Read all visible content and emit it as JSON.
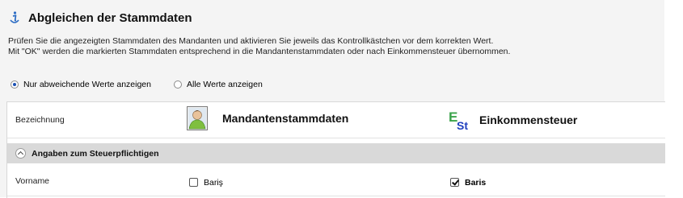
{
  "header": {
    "title": "Abgleichen der Stammdaten",
    "icon": "info-icon",
    "description_lines": [
      "Prüfen Sie die angezeigten Stammdaten des Mandanten und aktivieren Sie jeweils das Kontrollkästchen vor dem korrekten Wert.",
      "Mit \"OK\" werden die markierten Stammdaten entsprechend in die Mandantenstammdaten oder nach Einkommensteuer übernommen."
    ]
  },
  "filter": {
    "options": [
      {
        "label": "Nur abweichende Werte anzeigen",
        "selected": true
      },
      {
        "label": "Alle Werte anzeigen",
        "selected": false
      }
    ]
  },
  "table": {
    "header": {
      "label": "Bezeichnung",
      "col1": {
        "title": "Mandantenstammdaten",
        "icon": "person-icon"
      },
      "col2": {
        "title": "Einkommensteuer",
        "icon": "est-icon"
      }
    },
    "section": {
      "title": "Angaben zum Steuerpflichtigen",
      "icon": "chevron-up-icon"
    },
    "rows": [
      {
        "label": "Vorname",
        "col1_value": "Bariş",
        "col1_checked": false,
        "col2_value": "Baris",
        "col2_checked": true
      }
    ]
  },
  "colors": {
    "accent": "#1a4fb3",
    "section_bg": "#d9d9d9",
    "panel_bg": "#f4f4f4"
  }
}
